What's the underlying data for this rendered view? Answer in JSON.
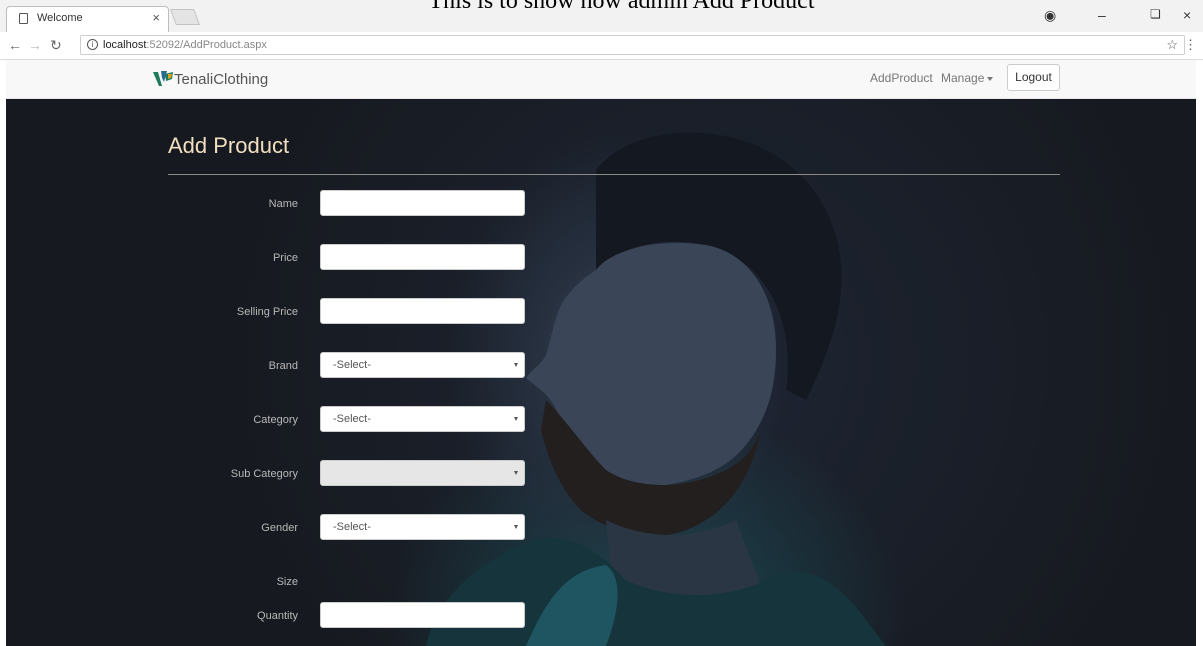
{
  "caption": "This is to show how admin Add Product",
  "browser": {
    "tab_title": "Welcome",
    "url_host": "localhost",
    "url_path": ":52092/AddProduct.aspx"
  },
  "navbar": {
    "brand": "TenaliClothing",
    "add_product": "AddProduct",
    "manage": "Manage",
    "logout": "Logout"
  },
  "form": {
    "title": "Add Product",
    "name_label": "Name",
    "price_label": "Price",
    "selling_price_label": "Selling Price",
    "brand_label": "Brand",
    "brand_value": "-Select-",
    "category_label": "Category",
    "category_value": "-Select-",
    "subcategory_label": "Sub Category",
    "gender_label": "Gender",
    "gender_value": "-Select-",
    "size_label": "Size",
    "quantity_label": "Quantity"
  },
  "colors": {
    "heading": "#f0dfc0",
    "labels": "#b8b8b8",
    "navbar": "#f8f8f8"
  }
}
